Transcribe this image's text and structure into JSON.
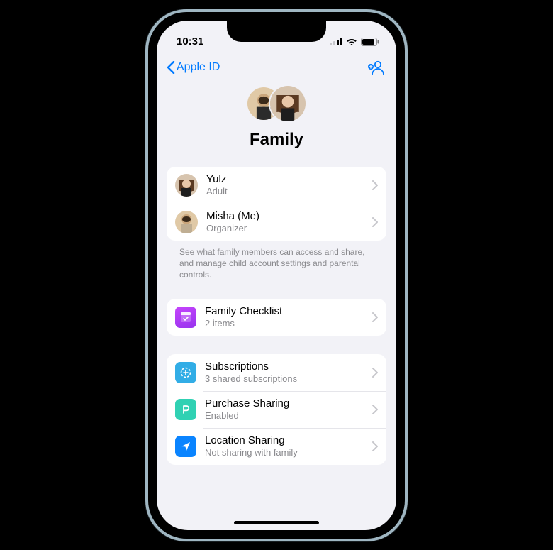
{
  "status": {
    "time": "10:31"
  },
  "nav": {
    "back_label": "Apple ID"
  },
  "hero": {
    "title": "Family"
  },
  "members": [
    {
      "name": "Yulz",
      "role": "Adult"
    },
    {
      "name": "Misha (Me)",
      "role": "Organizer"
    }
  ],
  "members_footer": "See what family members can access and share, and manage child account settings and parental controls.",
  "checklist": {
    "title": "Family Checklist",
    "subtitle": "2 items"
  },
  "sharing": {
    "subscriptions": {
      "title": "Subscriptions",
      "subtitle": "3 shared subscriptions"
    },
    "purchase": {
      "title": "Purchase Sharing",
      "subtitle": "Enabled"
    },
    "location": {
      "title": "Location Sharing",
      "subtitle": "Not sharing with family"
    }
  }
}
